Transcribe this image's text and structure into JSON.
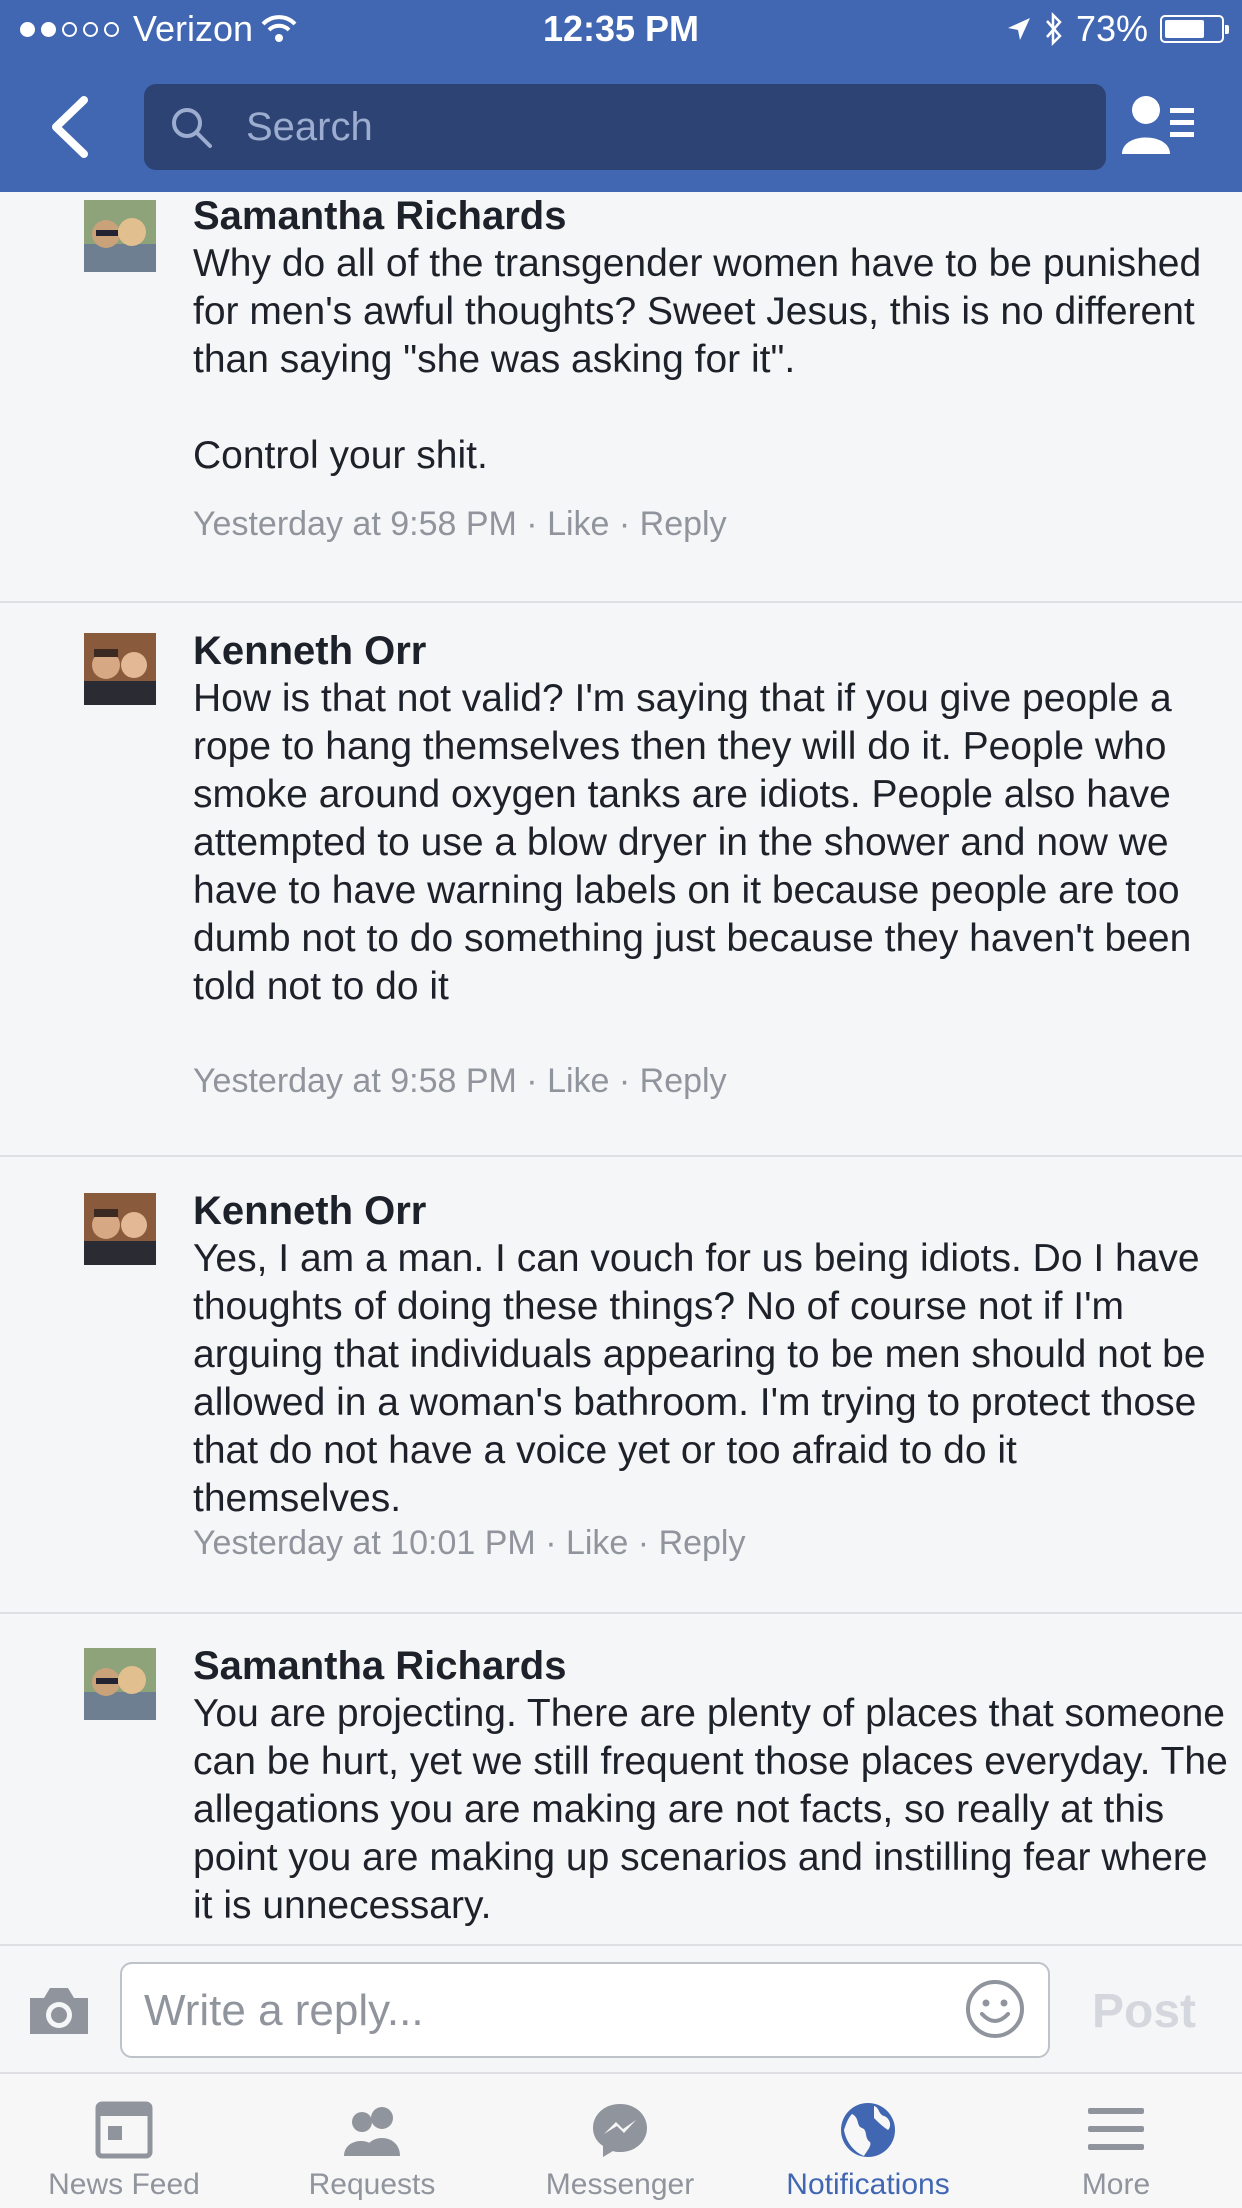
{
  "status_bar": {
    "carrier": "Verizon",
    "time": "12:35 PM",
    "battery": "73%",
    "battery_level": 0.73
  },
  "navbar": {
    "search_placeholder": "Search"
  },
  "comments": [
    {
      "name": "Samantha Richards",
      "text": "Why do all of the transgender women have to be punished for men's awful thoughts? Sweet Jesus, this is no different than saying \"she was asking for it\".\n\nControl your shit.",
      "time": "Yesterday at 9:58 PM",
      "like": "Like",
      "reply": "Reply"
    },
    {
      "name": "Kenneth Orr",
      "text": "How is that not valid? I'm saying that if you give people a rope to hang themselves then they will do it. People who smoke around oxygen tanks are idiots. People also have attempted to use a blow dryer in the shower and now we have to have warning labels on it because people are too dumb not to do something just because they haven't been told not to do it",
      "time": "Yesterday at 9:58 PM",
      "like": "Like",
      "reply": "Reply"
    },
    {
      "name": "Kenneth Orr",
      "text": "Yes, I am a man. I can vouch for us being idiots. Do I have thoughts of doing these things? No of course not if I'm arguing that individuals appearing to be men should not be allowed in a woman's bathroom. I'm trying to protect those that do not have a voice yet or too afraid to do it themselves.",
      "time": "Yesterday at 10:01 PM",
      "like": "Like",
      "reply": "Reply"
    },
    {
      "name": "Samantha Richards",
      "text": "You are projecting. There are plenty of places that someone can be hurt, yet we still frequent those places everyday. The allegations you are making are not facts, so really at this point you are making up scenarios and instilling fear where it is unnecessary.",
      "time": "",
      "like": "",
      "reply": ""
    }
  ],
  "composer": {
    "placeholder": "Write a reply...",
    "post_label": "Post"
  },
  "tabs": [
    {
      "label": "News Feed",
      "icon": "news-feed-icon"
    },
    {
      "label": "Requests",
      "icon": "requests-icon"
    },
    {
      "label": "Messenger",
      "icon": "messenger-icon"
    },
    {
      "label": "Notifications",
      "icon": "globe-icon",
      "active": true
    },
    {
      "label": "More",
      "icon": "menu-icon"
    }
  ],
  "colors": {
    "brand": "#4267b2",
    "search_bg": "#2d4373",
    "muted": "#90949c"
  }
}
